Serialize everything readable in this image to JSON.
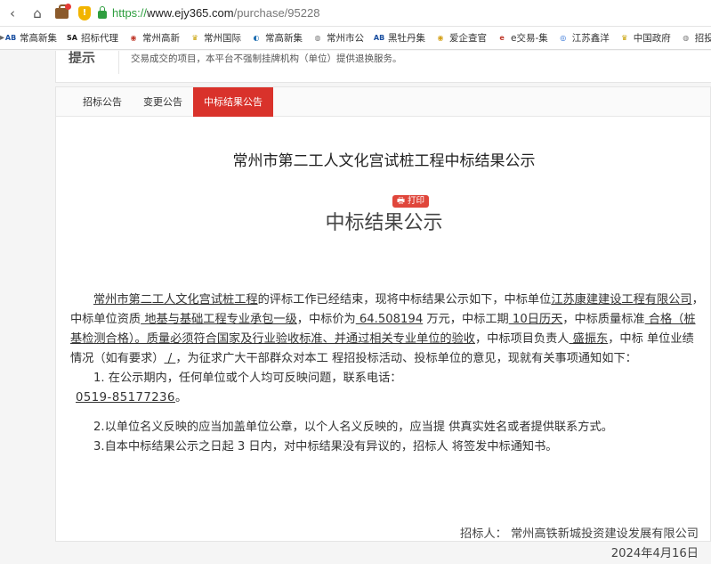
{
  "browser": {
    "nav": {
      "back": "‹",
      "home": "⌂"
    },
    "url": {
      "scheme": "https://",
      "host": "www.ejy365.com",
      "path": "/purchase/95228"
    },
    "shield_mark": "!"
  },
  "bookmarks": [
    {
      "icon": "AB",
      "icon_color": "#1a4fa0",
      "label": "常高新集"
    },
    {
      "icon": "SA",
      "icon_color": "#1a1a1a",
      "label": "招标代理"
    },
    {
      "icon": "◉",
      "icon_color": "#c0392b",
      "label": "常州高新"
    },
    {
      "icon": "♛",
      "icon_color": "#c8a000",
      "label": "常州国际"
    },
    {
      "icon": "◐",
      "icon_color": "#1f6fb2",
      "label": "常高新集"
    },
    {
      "icon": "◍",
      "icon_color": "#777777",
      "label": "常州市公"
    },
    {
      "icon": "AB",
      "icon_color": "#1a4fa0",
      "label": "黑牡丹集"
    },
    {
      "icon": "◉",
      "icon_color": "#d4a017",
      "label": "爱企查官"
    },
    {
      "icon": "e",
      "icon_color": "#c0392b",
      "label": "e交易-集"
    },
    {
      "icon": "◎",
      "icon_color": "#2b6fd6",
      "label": "江苏鑫洋"
    },
    {
      "icon": "♛",
      "icon_color": "#c8a000",
      "label": "中国政府"
    },
    {
      "icon": "◍",
      "icon_color": "#777777",
      "label": "招投标交"
    }
  ],
  "tip": {
    "title": "提示",
    "text": "交易成交的项目，本平台不强制挂牌机构（单位）提供退换服务。"
  },
  "tabs": [
    {
      "label": "招标公告",
      "active": false
    },
    {
      "label": "变更公告",
      "active": false
    },
    {
      "label": "中标结果公告",
      "active": true
    }
  ],
  "document": {
    "title": "常州市第二工人文化宫试桩工程中标结果公示",
    "print_label": "🖶 打印",
    "subtitle": "中标结果公示",
    "para": {
      "project": "常州市第二工人文化宫试桩工程",
      "t1": "的评标工作已经结束，现将中标结果公示如下，中标单位",
      "winner": "江苏康建建设工程有限公司",
      "t2": "，中标单位资质",
      "qualification": " 地基与基础工程专业承包一级",
      "t3": "，中标价为",
      "price": "  64.508194",
      "t4": " 万元，中标工期",
      "period": " 10日历天",
      "t5": "，中标质量标准",
      "quality": " 合格（桩基检测合格）。质量必须符合国家及行业验收标准、并通过相关专业单位的验收",
      "t6": "，中标项目负责人",
      "manager": " 盛振东",
      "t7": "，中标 单位业绩情况（如有要求）",
      "performance": "  /  ",
      "t8": "，为征求广大干部群众对本工 程招投标活动、投标单位的意见，现就有关事项通知如下："
    },
    "item1": "1. 在公示期内，任何单位或个人均可反映问题，联系电话：",
    "phone": "0519-85177236 ",
    "phone_end": "。",
    "item2": "2.以单位名义反映的应当加盖单位公章，以个人名义反映的，应当提 供真实姓名或者提供联系方式。",
    "item3": "3.自本中标结果公示之日起 3 日内，对中标结果没有异议的，招标人 将签发中标通知书。",
    "signer": "招标人：  常州高铁新城投资建设发展有限公司",
    "date": "2024年4月16日"
  }
}
